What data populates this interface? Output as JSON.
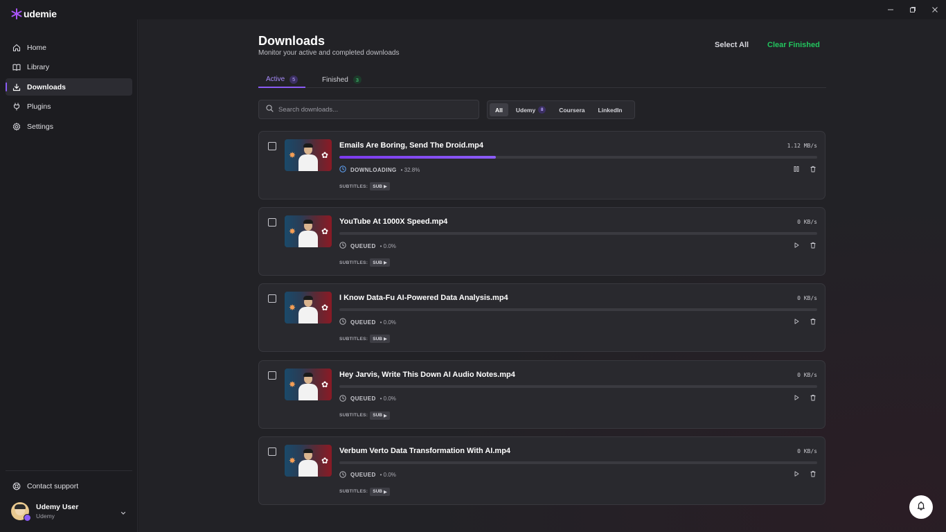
{
  "app": {
    "logo_text": "udemie"
  },
  "window_controls": [
    "minimize",
    "restore",
    "close"
  ],
  "sidebar": {
    "items": [
      {
        "label": "Home",
        "icon": "home-icon",
        "active": false
      },
      {
        "label": "Library",
        "icon": "book-icon",
        "active": false
      },
      {
        "label": "Downloads",
        "icon": "download-icon",
        "active": true
      },
      {
        "label": "Plugins",
        "icon": "plug-icon",
        "active": false
      },
      {
        "label": "Settings",
        "icon": "gear-icon",
        "active": false
      }
    ],
    "support_label": "Contact support",
    "user": {
      "name": "Udemy User",
      "subtitle": "Udemy"
    }
  },
  "header": {
    "title": "Downloads",
    "subtitle": "Monitor your active and completed downloads",
    "select_all": "Select All",
    "clear_finished": "Clear Finished"
  },
  "tabs": [
    {
      "label": "Active",
      "count": "5",
      "active": true
    },
    {
      "label": "Finished",
      "count": "3",
      "active": false
    }
  ],
  "search": {
    "placeholder": "Search downloads..."
  },
  "filters": [
    {
      "label": "All",
      "active": true,
      "count": ""
    },
    {
      "label": "Udemy",
      "active": false,
      "count": "8"
    },
    {
      "label": "Coursera",
      "active": false,
      "count": ""
    },
    {
      "label": "LinkedIn",
      "active": false,
      "count": ""
    }
  ],
  "downloads": [
    {
      "title": "Emails Are Boring, Send The Droid.mp4",
      "speed": "1.12 MB/s",
      "status": "DOWNLOADING",
      "percent_text": "• 32.8%",
      "progress": 0.328,
      "primary_action": "pause",
      "subtitles_label": "SUBTITLES:",
      "subtitles_badge": "SUB"
    },
    {
      "title": "YouTube At 1000X Speed.mp4",
      "speed": "0 KB/s",
      "status": "QUEUED",
      "percent_text": "• 0.0%",
      "progress": 0,
      "primary_action": "play",
      "subtitles_label": "SUBTITLES:",
      "subtitles_badge": "SUB"
    },
    {
      "title": "I Know Data-Fu AI-Powered Data Analysis.mp4",
      "speed": "0 KB/s",
      "status": "QUEUED",
      "percent_text": "• 0.0%",
      "progress": 0,
      "primary_action": "play",
      "subtitles_label": "SUBTITLES:",
      "subtitles_badge": "SUB"
    },
    {
      "title": "Hey Jarvis, Write This Down AI Audio Notes.mp4",
      "speed": "0 KB/s",
      "status": "QUEUED",
      "percent_text": "• 0.0%",
      "progress": 0,
      "primary_action": "play",
      "subtitles_label": "SUBTITLES:",
      "subtitles_badge": "SUB"
    },
    {
      "title": "Verbum Verto Data Transformation With AI.mp4",
      "speed": "0 KB/s",
      "status": "QUEUED",
      "percent_text": "• 0.0%",
      "progress": 0,
      "primary_action": "play",
      "subtitles_label": "SUBTITLES:",
      "subtitles_badge": "SUB"
    }
  ],
  "colors": {
    "accent": "#8b5cf6",
    "success": "#22c55e",
    "background": "#1c1c20",
    "card": "#29292e"
  }
}
